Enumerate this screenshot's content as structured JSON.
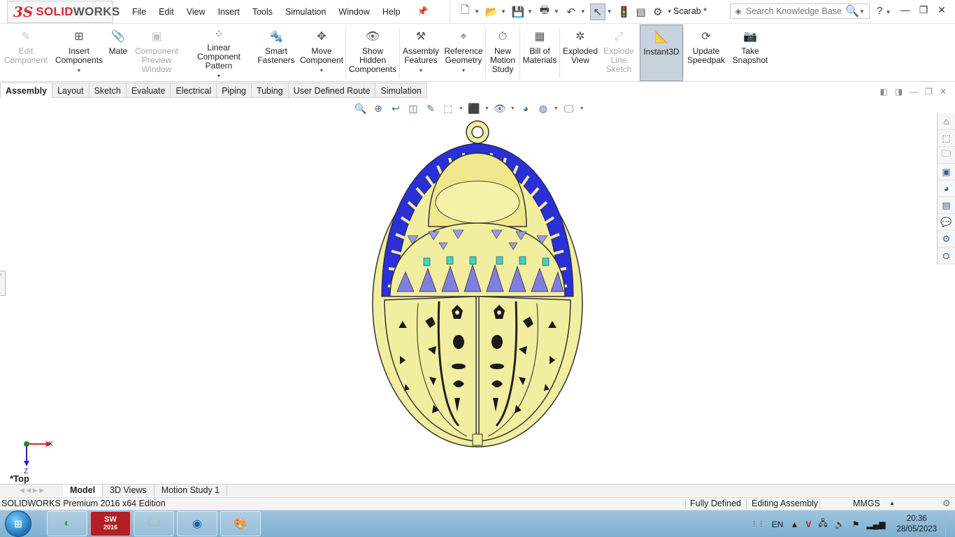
{
  "app": {
    "logo_ds": "3S",
    "logo_name_a": "SOLID",
    "logo_name_b": "WORKS",
    "document_title": "Scarab *"
  },
  "menu": [
    "File",
    "Edit",
    "View",
    "Insert",
    "Tools",
    "Simulation",
    "Window",
    "Help"
  ],
  "search": {
    "placeholder": "Search Knowledge Base"
  },
  "ribbon": [
    {
      "label": "Edit Component",
      "icon": "edit-component-icon",
      "disabled": true
    },
    {
      "label": "Insert Components",
      "icon": "insert-components-icon",
      "dropdown": true
    },
    {
      "label": "Mate",
      "icon": "mate-icon"
    },
    {
      "label": "Component Preview Window",
      "icon": "preview-window-icon",
      "disabled": true
    },
    {
      "label": "Linear Component Pattern",
      "icon": "linear-pattern-icon",
      "dropdown": true
    },
    {
      "label": "Smart Fasteners",
      "icon": "smart-fasteners-icon"
    },
    {
      "label": "Move Component",
      "icon": "move-component-icon",
      "dropdown": true
    },
    {
      "label": "Show Hidden Components",
      "icon": "show-hidden-icon"
    },
    {
      "label": "Assembly Features",
      "icon": "assembly-features-icon",
      "dropdown": true
    },
    {
      "label": "Reference Geometry",
      "icon": "reference-geometry-icon",
      "dropdown": true
    },
    {
      "label": "New Motion Study",
      "icon": "motion-study-icon"
    },
    {
      "label": "Bill of Materials",
      "icon": "bom-icon"
    },
    {
      "label": "Exploded View",
      "icon": "exploded-view-icon"
    },
    {
      "label": "Explode Line Sketch",
      "icon": "explode-line-icon",
      "disabled": true
    },
    {
      "label": "Instant3D",
      "icon": "instant3d-icon",
      "active": true
    },
    {
      "label": "Update Speedpak",
      "icon": "speedpak-icon"
    },
    {
      "label": "Take Snapshot",
      "icon": "camera-icon"
    }
  ],
  "tabs": [
    "Assembly",
    "Layout",
    "Sketch",
    "Evaluate",
    "Electrical",
    "Piping",
    "Tubing",
    "User Defined Route",
    "Simulation"
  ],
  "active_tab": "Assembly",
  "viewport": {
    "view_name": "*Top",
    "triad_x": "X",
    "triad_z": "Z"
  },
  "bottom_tabs": [
    "Model",
    "3D Views",
    "Motion Study 1"
  ],
  "status": {
    "edition": "SOLIDWORKS Premium 2016 x64 Edition",
    "definition": "Fully Defined",
    "mode": "Editing Assembly",
    "units": "MMGS"
  },
  "taskbar": {
    "language": "EN",
    "time": "20:36",
    "date": "28/05/2023",
    "sw_badge": "2016"
  },
  "colors": {
    "brand_red": "#d7282f",
    "model_yellow": "#f2eea0",
    "model_blue": "#2a2fd6",
    "taskbar": "#8fbbd7"
  }
}
